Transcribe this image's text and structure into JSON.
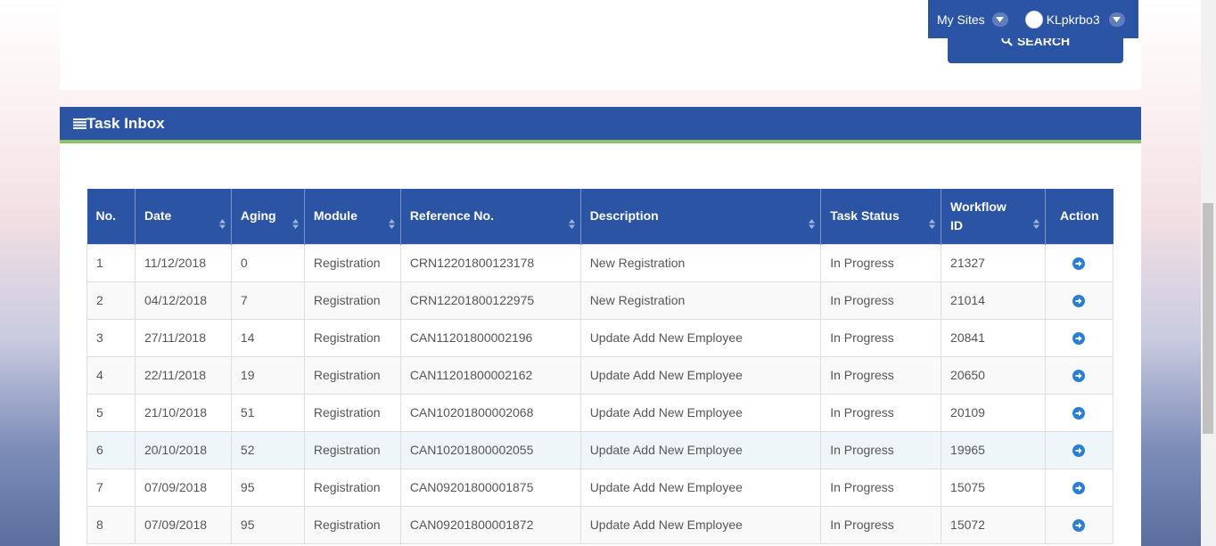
{
  "header": {
    "search_label": "SEARCH",
    "my_sites": "My Sites",
    "username": "KLpkrbo3"
  },
  "inbox": {
    "title": "Task Inbox",
    "columns": [
      "No.",
      "Date",
      "Aging",
      "Module",
      "Reference No.",
      "Description",
      "Task Status",
      "Workflow ID",
      "Action"
    ],
    "rows": [
      {
        "no": "1",
        "date": "11/12/2018",
        "aging": "0",
        "module": "Registration",
        "ref": "CRN12201800123178",
        "desc": "New Registration",
        "status": "In Progress",
        "wf": "21327"
      },
      {
        "no": "2",
        "date": "04/12/2018",
        "aging": "7",
        "module": "Registration",
        "ref": "CRN12201800122975",
        "desc": "New Registration",
        "status": "In Progress",
        "wf": "21014"
      },
      {
        "no": "3",
        "date": "27/11/2018",
        "aging": "14",
        "module": "Registration",
        "ref": "CAN11201800002196",
        "desc": "Update Add New Employee",
        "status": "In Progress",
        "wf": "20841"
      },
      {
        "no": "4",
        "date": "22/11/2018",
        "aging": "19",
        "module": "Registration",
        "ref": "CAN11201800002162",
        "desc": "Update Add New Employee",
        "status": "In Progress",
        "wf": "20650"
      },
      {
        "no": "5",
        "date": "21/10/2018",
        "aging": "51",
        "module": "Registration",
        "ref": "CAN10201800002068",
        "desc": "Update Add New Employee",
        "status": "In Progress",
        "wf": "20109"
      },
      {
        "no": "6",
        "date": "20/10/2018",
        "aging": "52",
        "module": "Registration",
        "ref": "CAN10201800002055",
        "desc": "Update Add New Employee",
        "status": "In Progress",
        "wf": "19965"
      },
      {
        "no": "7",
        "date": "07/09/2018",
        "aging": "95",
        "module": "Registration",
        "ref": "CAN09201800001875",
        "desc": "Update Add New Employee",
        "status": "In Progress",
        "wf": "15075"
      },
      {
        "no": "8",
        "date": "07/09/2018",
        "aging": "95",
        "module": "Registration",
        "ref": "CAN09201800001872",
        "desc": "Update Add New Employee",
        "status": "In Progress",
        "wf": "15072"
      }
    ],
    "action_icon": "arrow-circle-right-icon"
  },
  "colors": {
    "primary": "#2b55a4",
    "accent_green": "#8cc460",
    "action_blue": "#2a7fd4"
  }
}
